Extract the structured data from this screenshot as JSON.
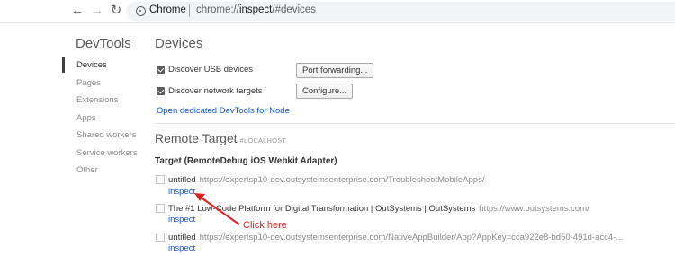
{
  "browser": {
    "back_icon": "arrow-left-icon",
    "forward_icon": "arrow-right-icon",
    "reload_icon": "reload-icon",
    "omnibox": {
      "site_label": "Chrome",
      "url_scheme": "chrome://",
      "url_host": "inspect",
      "url_path": "/#devices"
    }
  },
  "sidebar": {
    "title": "DevTools",
    "items": [
      {
        "label": "Devices",
        "active": true
      },
      {
        "label": "Pages",
        "active": false
      },
      {
        "label": "Extensions",
        "active": false
      },
      {
        "label": "Apps",
        "active": false
      },
      {
        "label": "Shared workers",
        "active": false
      },
      {
        "label": "Service workers",
        "active": false
      },
      {
        "label": "Other",
        "active": false
      }
    ]
  },
  "devices": {
    "title": "Devices",
    "usb": {
      "label": "Discover USB devices",
      "checked": true,
      "button": "Port forwarding..."
    },
    "network": {
      "label": "Discover network targets",
      "checked": true,
      "button": "Configure..."
    },
    "node_link": "Open dedicated DevTools for Node"
  },
  "remote": {
    "title": "Remote Target",
    "tag": "#LOCALHOST",
    "target_header": "Target (RemoteDebug iOS Webkit Adapter)",
    "targets": [
      {
        "name": "untitled",
        "url": "https://expertsp10-dev.outsystemsenterprise.com/TroubleshootMobileApps/",
        "action": "inspect"
      },
      {
        "name": "The #1 Low-Code Platform for Digital Transformation | OutSystems | OutSystems",
        "url": "https://www.outsystems.com/",
        "action": "inspect"
      },
      {
        "name": "untitled",
        "url": "https://expertsp10-dev.outsystemsenterprise.com/NativeAppBuilder/App?AppKey=cca922e8-bd50-491d-acc4-...",
        "action": "inspect"
      }
    ]
  },
  "annotation": {
    "text": "Click here",
    "color": "#e02020"
  },
  "colors": {
    "link": "#1155cc",
    "accent_marker": "#3c4043"
  }
}
